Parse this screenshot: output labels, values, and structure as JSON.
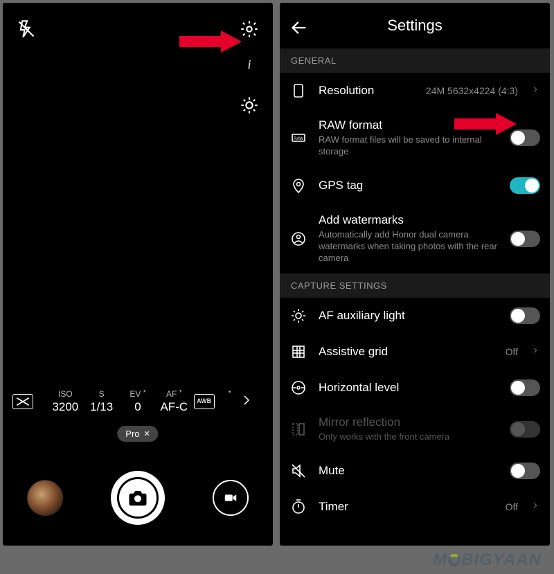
{
  "leftPanel": {
    "proRow": {
      "iso": {
        "label": "ISO",
        "value": "3200"
      },
      "shutter": {
        "label": "S",
        "value": "1/13"
      },
      "ev": {
        "label": "EV",
        "value": "0",
        "star": "*"
      },
      "af": {
        "label": "AF",
        "value": "AF-C",
        "star": "*"
      },
      "awb": {
        "label": "AWB",
        "star": "*"
      }
    },
    "modeBadge": "Pro"
  },
  "rightPanel": {
    "title": "Settings",
    "sections": {
      "general": {
        "header": "GENERAL",
        "resolution": {
          "title": "Resolution",
          "value": "24M 5632x4224 (4:3)"
        },
        "raw": {
          "title": "RAW format",
          "sub": "RAW format files will be saved to internal storage"
        },
        "gps": {
          "title": "GPS tag"
        },
        "watermark": {
          "title": "Add watermarks",
          "sub": "Automatically add Honor dual camera watermarks when taking photos with the rear camera"
        }
      },
      "capture": {
        "header": "CAPTURE SETTINGS",
        "afLight": {
          "title": "AF auxiliary light"
        },
        "grid": {
          "title": "Assistive grid",
          "value": "Off"
        },
        "horizontal": {
          "title": "Horizontal level"
        },
        "mirror": {
          "title": "Mirror reflection",
          "sub": "Only works with the front camera"
        },
        "mute": {
          "title": "Mute"
        },
        "timer": {
          "title": "Timer",
          "value": "Off"
        }
      }
    }
  },
  "watermarkBrand": {
    "pre": "M",
    "post": "BIGYAAN"
  }
}
